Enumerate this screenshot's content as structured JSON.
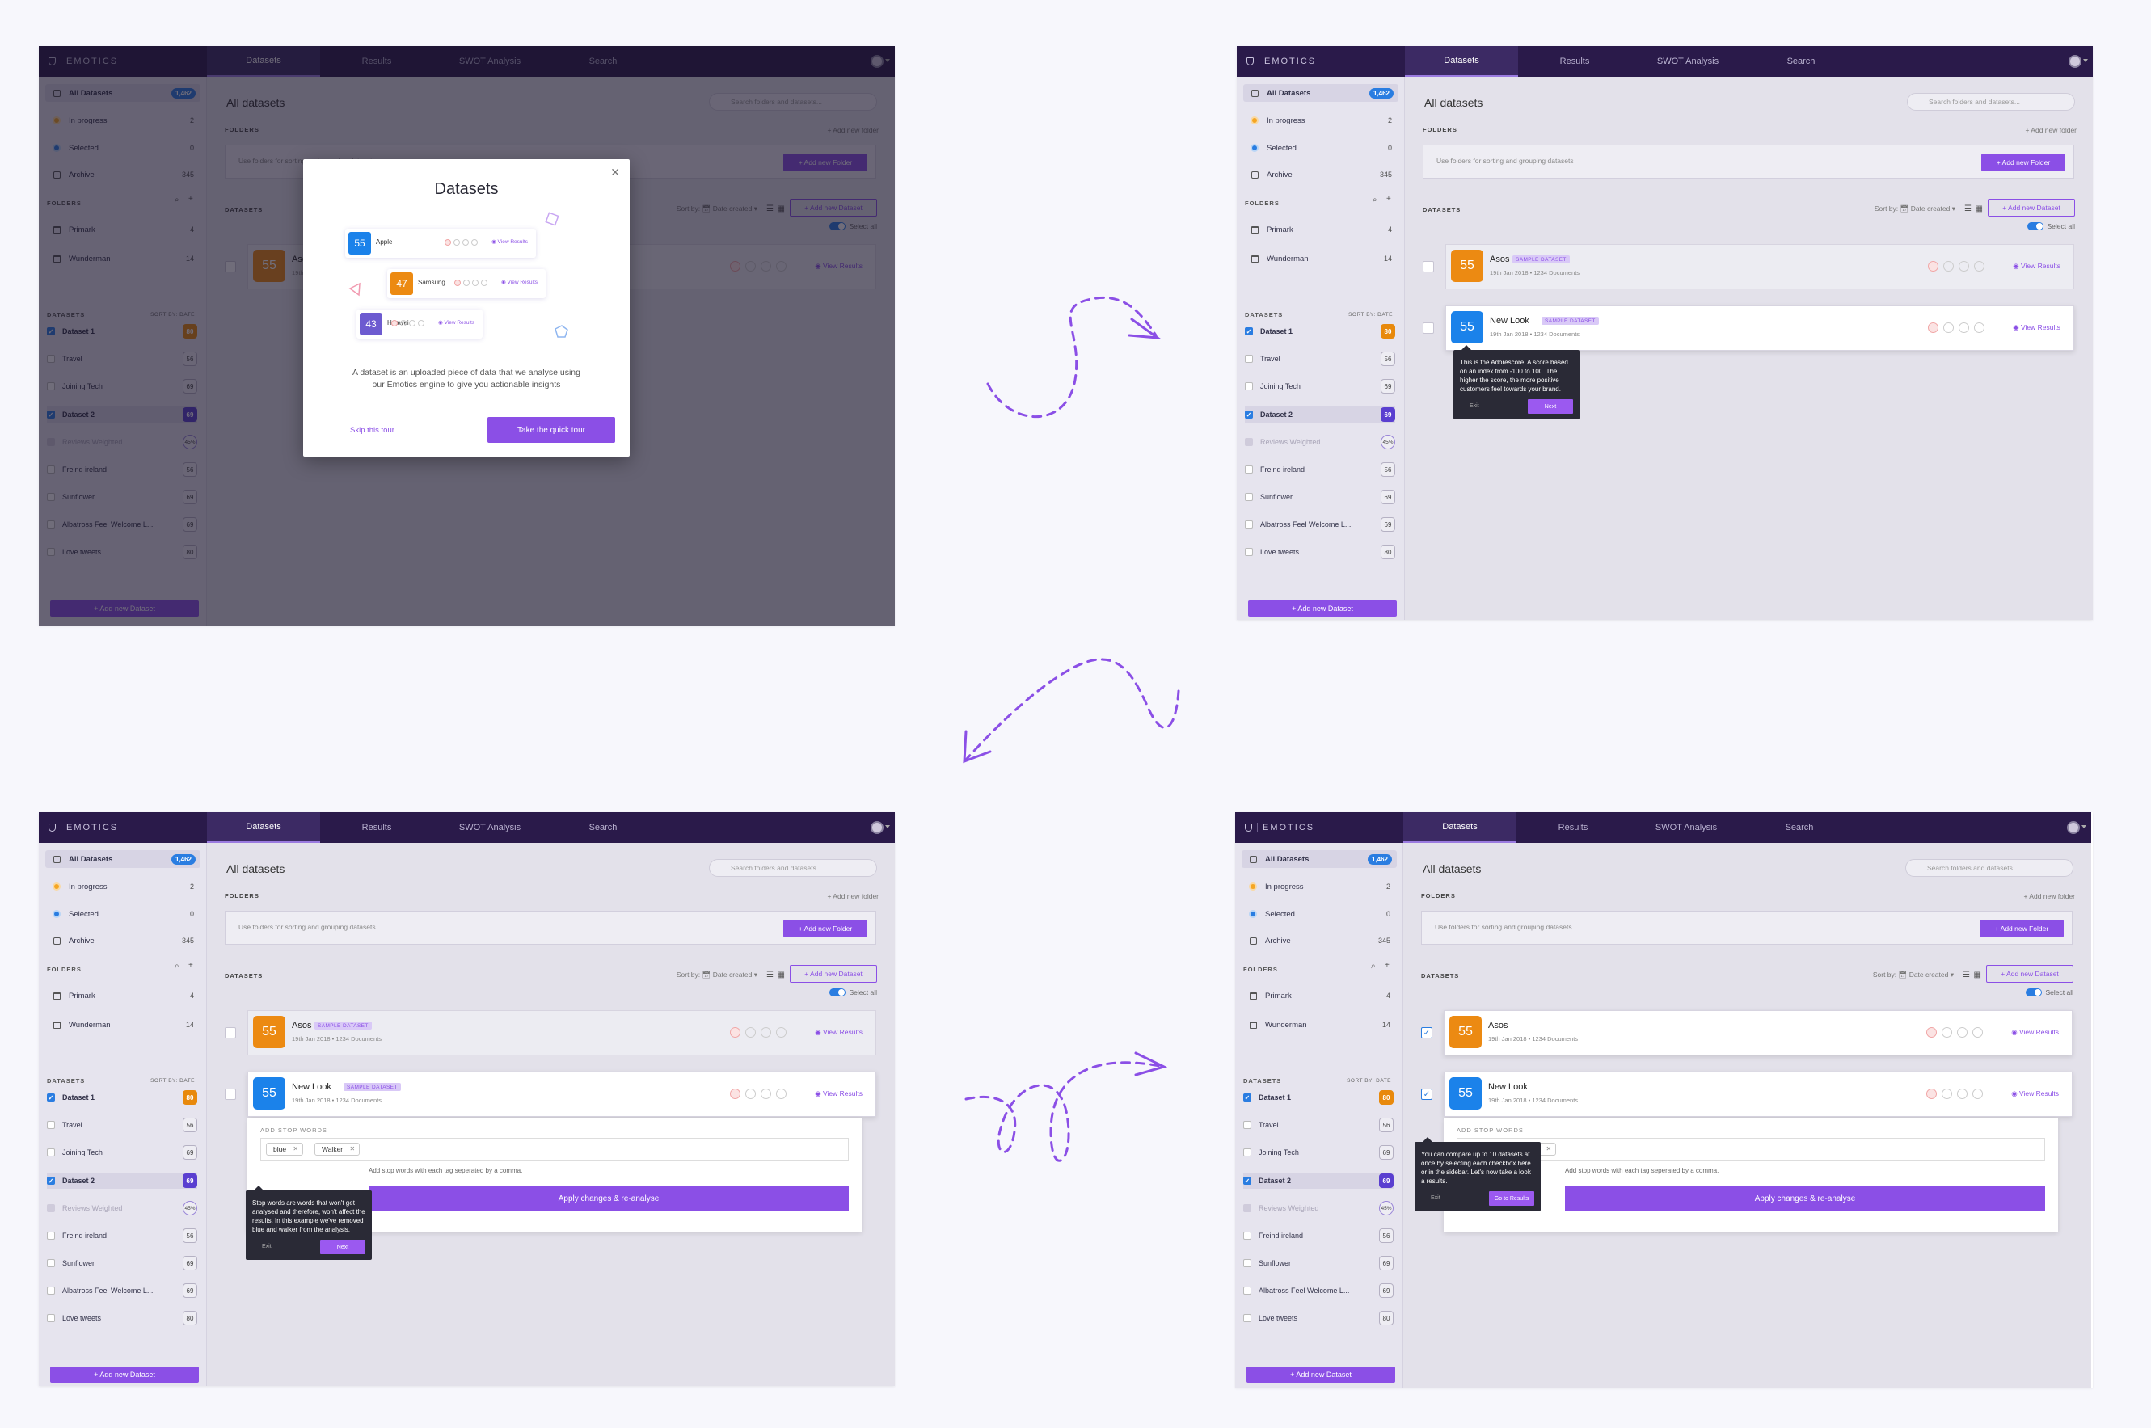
{
  "app": {
    "brand": "EMOTICS",
    "nav_tabs": [
      "Datasets",
      "Results",
      "SWOT Analysis",
      "Search"
    ]
  },
  "sidebar": {
    "items": [
      {
        "label": "All Datasets",
        "count": "1,462"
      },
      {
        "label": "In progress",
        "count": "2"
      },
      {
        "label": "Selected",
        "count": "0"
      },
      {
        "label": "Archive",
        "count": "345"
      }
    ],
    "folders_head": "FOLDERS",
    "folders": [
      {
        "label": "Primark",
        "count": "4"
      },
      {
        "label": "Wunderman",
        "count": "14"
      }
    ],
    "datasets_head": "DATASETS",
    "sort_by": "SORT BY: DATE",
    "datasets": [
      {
        "label": "Dataset 1",
        "score": "80"
      },
      {
        "label": "Travel",
        "score": "56"
      },
      {
        "label": "Joining Tech",
        "score": "69"
      },
      {
        "label": "Dataset 2",
        "score": "69"
      },
      {
        "label": "Reviews Weighted",
        "score": "45%"
      },
      {
        "label": "Freind ireland",
        "score": "56"
      },
      {
        "label": "Sunflower",
        "score": "69"
      },
      {
        "label": "Albatross Feel Welcome L...",
        "score": "69"
      },
      {
        "label": "Love tweets",
        "score": "80"
      }
    ],
    "add_dataset": "+ Add new Dataset"
  },
  "main": {
    "title": "All datasets",
    "search_placeholder": "Search folders and datasets...",
    "folders_label": "FOLDERS",
    "add_folder_link": "+ Add new folder",
    "folders_hint": "Use folders for sorting and grouping datasets",
    "add_folder_btn": "+ Add new Folder",
    "datasets_label": "DATASETS",
    "sort_by": "Sort by:",
    "sort_value": "Date created",
    "add_dataset_btn": "+ Add new Dataset",
    "select_all": "Select all",
    "view_results": "View Results",
    "sample_tag": "SAMPLE DATASET",
    "cards": [
      {
        "name": "Asos",
        "score": "55",
        "meta": "19th Jan 2018 • 1234 Documents"
      },
      {
        "name": "New Look",
        "score": "55",
        "meta": "19th Jan 2018 • 1234 Documents"
      }
    ],
    "stop_words_label": "ADD STOP WORDS",
    "chips": [
      "blue",
      "Walker"
    ],
    "stop_hint": "Add stop words with each tag seperated by a comma.",
    "apply_btn": "Apply changes & re-analyse"
  },
  "modal": {
    "title": "Datasets",
    "desc": "A dataset is an uploaded piece of data that we analyse using our Emotics engine to give you actionable insights",
    "skip": "Skip this tour",
    "tour": "Take the quick tour",
    "examples": [
      {
        "name": "Apple",
        "score": "55",
        "color": "#1b82ea"
      },
      {
        "name": "Samsung",
        "score": "47",
        "color": "#ec8a12"
      },
      {
        "name": "Huawei",
        "score": "43",
        "color": "#6d5bd0"
      }
    ]
  },
  "tips": [
    {
      "text": "This is the Adorescore. A score based on an index from -100 to 100. The higher the score, the more positive customers feel towards your brand.",
      "exit": "Exit",
      "next": "Next"
    },
    {
      "text": "Stop words are words that won't get analysed and therefore, won't affect the results. In this example we've removed blue and walker from the analysis.",
      "exit": "Exit",
      "next": "Next"
    },
    {
      "text": "You can compare up to 10 datasets at once by selecting each checkbox here or in the sidebar. Let's now take a look a results.",
      "exit": "Exit",
      "next": "Go to Results"
    }
  ],
  "colors": {
    "accent": "#8b4fe6",
    "nav": "#2a1a4a",
    "blue": "#1b82ea",
    "orange": "#ec8a12"
  }
}
